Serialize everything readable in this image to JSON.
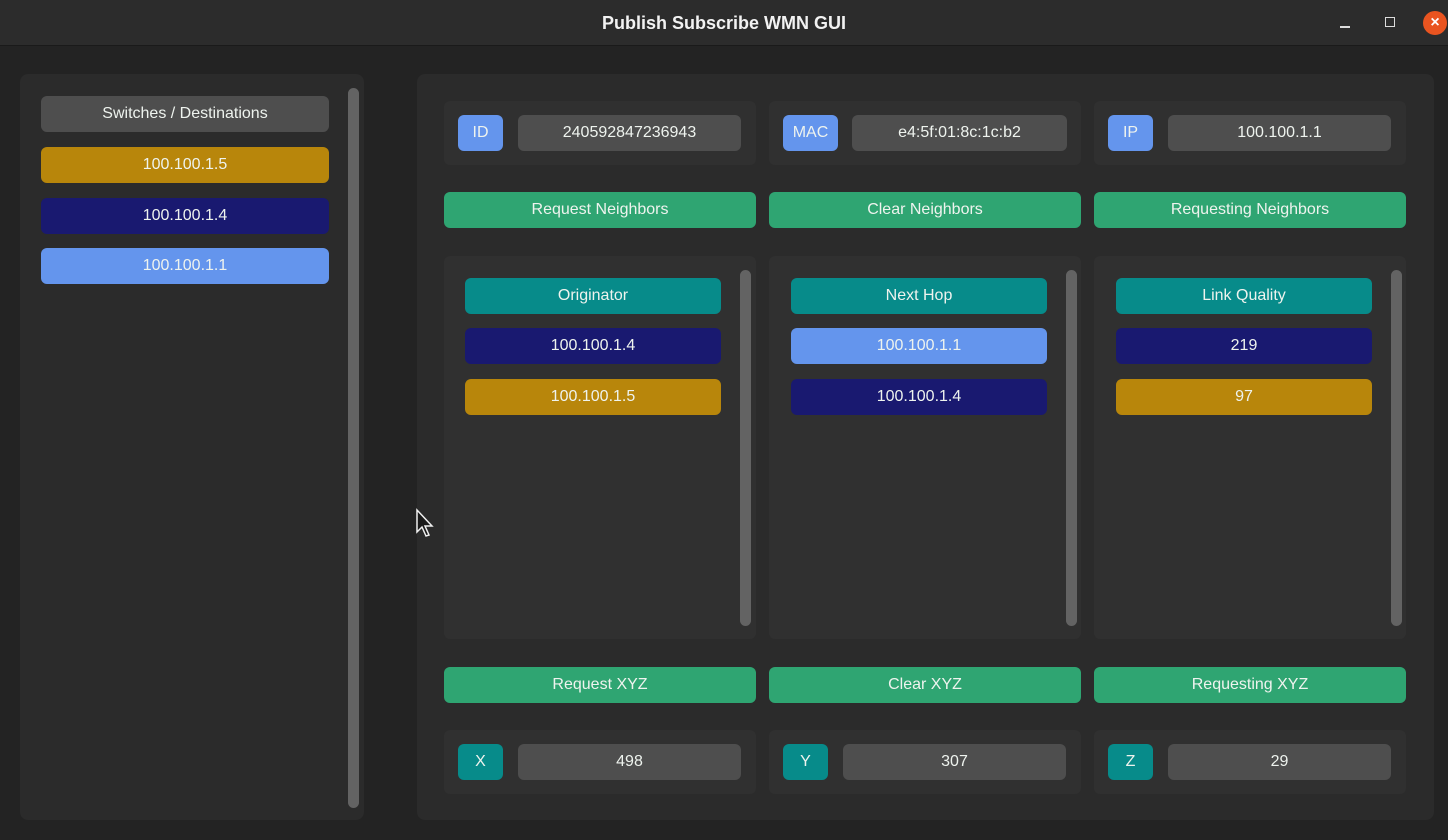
{
  "window": {
    "title": "Publish Subscribe WMN GUI",
    "controls": {
      "minimize": "minimize-icon",
      "maximize": "maximize-icon",
      "close": "close-icon",
      "close_glyph": "×"
    }
  },
  "sidebar": {
    "header": "Switches / Destinations",
    "items": [
      {
        "label": "100.100.1.5",
        "color": "#b8860b"
      },
      {
        "label": "100.100.1.4",
        "color": "#191970"
      },
      {
        "label": "100.100.1.1",
        "color": "#6495ed"
      }
    ]
  },
  "info": {
    "id": {
      "label": "ID",
      "value": "240592847236943"
    },
    "mac": {
      "label": "MAC",
      "value": "e4:5f:01:8c:1c:b2"
    },
    "ip": {
      "label": "IP",
      "value": "100.100.1.1"
    }
  },
  "neighbors_buttons": {
    "request": "Request Neighbors",
    "clear": "Clear Neighbors",
    "status": "Requesting Neighbors"
  },
  "tables": {
    "originator": {
      "header": "Originator",
      "rows": [
        "100.100.1.4",
        "100.100.1.5"
      ]
    },
    "next_hop": {
      "header": "Next Hop",
      "rows": [
        "100.100.1.1",
        "100.100.1.4"
      ]
    },
    "link_quality": {
      "header": "Link Quality",
      "rows": [
        "219",
        "97"
      ]
    }
  },
  "xyz_buttons": {
    "request": "Request XYZ",
    "clear": "Clear XYZ",
    "status": "Requesting XYZ"
  },
  "xyz": {
    "x": {
      "label": "X",
      "value": "498"
    },
    "y": {
      "label": "Y",
      "value": "307"
    },
    "z": {
      "label": "Z",
      "value": "29"
    }
  },
  "colors": {
    "accent_green": "#2fa572",
    "teal": "#078b8a",
    "gold": "#b8860b",
    "navy": "#191970",
    "sky": "#6495ed",
    "close": "#e95420"
  }
}
